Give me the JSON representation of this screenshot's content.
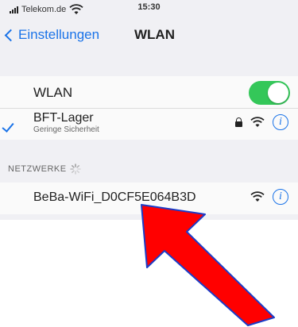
{
  "status": {
    "carrier": "Telekom.de",
    "time": "15:30"
  },
  "nav": {
    "back_label": "Einstellungen",
    "title": "WLAN"
  },
  "wlan_row": {
    "label": "WLAN",
    "enabled": true
  },
  "connected_network": {
    "name": "BFT-Lager",
    "note": "Geringe Sicherheit",
    "secured": true
  },
  "section": {
    "header": "NETZWERKE"
  },
  "networks": [
    {
      "name": "BeBa-WiFi_D0CF5E064B3D"
    }
  ],
  "icons": {
    "back": "chevron-left-icon",
    "check": "checkmark-icon",
    "lock": "lock-icon",
    "wifi": "wifi-icon",
    "info": "info-icon",
    "spinner": "loading-spinner-icon",
    "annotation": "red-arrow"
  },
  "colors": {
    "accent": "#1a73e8",
    "toggle_on": "#34c759",
    "arrow_fill": "#ff0000",
    "arrow_outline": "#1a3cc8"
  }
}
